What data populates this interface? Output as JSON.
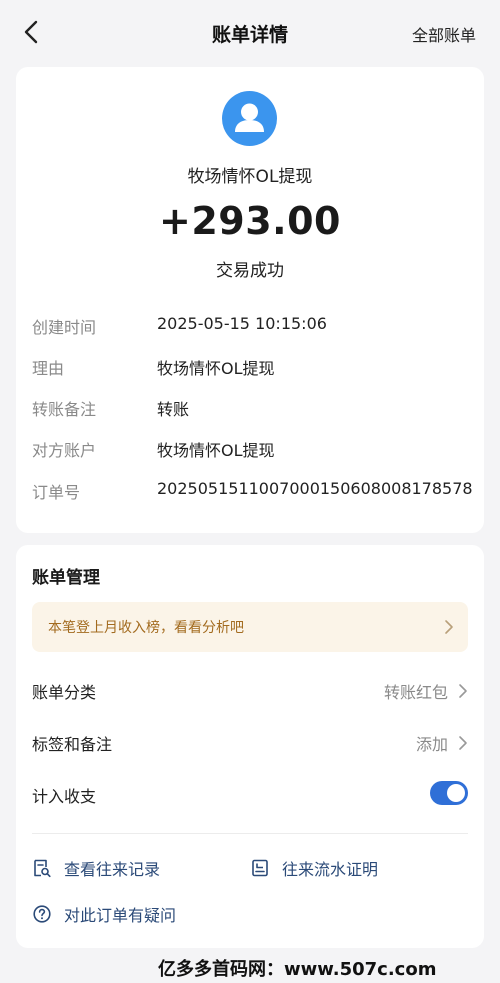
{
  "nav": {
    "title": "账单详情",
    "right_label": "全部账单"
  },
  "transaction": {
    "payer_name": "牧场情怀OL提现",
    "amount": "+293.00",
    "status": "交易成功"
  },
  "details": [
    {
      "label": "创建时间",
      "value": "2025-05-15 10:15:06"
    },
    {
      "label": "理由",
      "value": "牧场情怀OL提现"
    },
    {
      "label": "转账备注",
      "value": "转账"
    },
    {
      "label": "对方账户",
      "value": "牧场情怀OL提现"
    },
    {
      "label": "订单号",
      "value": "2025051511007000150608008178578"
    }
  ],
  "management": {
    "title": "账单管理",
    "banner": "本笔登上月收入榜，看看分析吧",
    "rows": [
      {
        "label": "账单分类",
        "value": "转账红包"
      },
      {
        "label": "标签和备注",
        "value": "添加"
      },
      {
        "label": "计入收支",
        "toggle_on": true
      }
    ],
    "links": [
      {
        "label": "查看往来记录"
      },
      {
        "label": "往来流水证明"
      },
      {
        "label": "对此订单有疑问"
      }
    ]
  },
  "watermark": "亿多多首码网：www.507c.com",
  "colors": {
    "accent": "#2f6fd7",
    "avatar": "#3b95ee",
    "banner_bg": "#fbf4e8",
    "banner_text": "#a36b1f",
    "link": "#2b4a78"
  }
}
